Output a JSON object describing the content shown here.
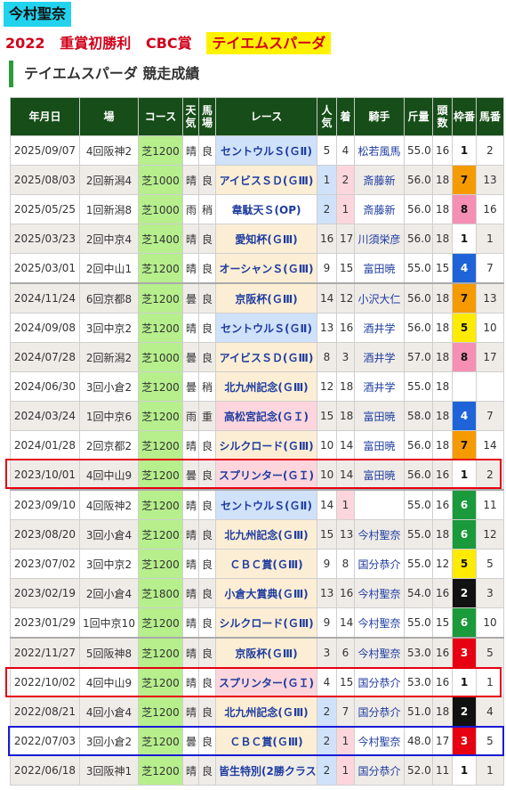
{
  "jockey": "今村聖奈",
  "headline": {
    "year": "2022",
    "title": "重賞初勝利",
    "race": "CBC賞",
    "horse": "テイエムスパーダ"
  },
  "section": {
    "horse": "テイエムスパーダ",
    "label": "競走成績"
  },
  "colors": {
    "header_bg": "#164d18",
    "course_bg": "#b6ef8c",
    "g1_bg": "#fcd6dc",
    "g2_bg": "#cfe2fa",
    "g3_bg": "#fbeed4",
    "accent_red": "#e60012",
    "accent_blue": "#1a1ad6"
  },
  "columns": [
    "年月日",
    "場",
    "コース",
    "天気",
    "馬場",
    "レース",
    "人気",
    "着",
    "騎手",
    "斤量",
    "頭数",
    "枠番",
    "馬番"
  ],
  "rows": [
    {
      "date": "2025/09/07",
      "track": "4回阪神2",
      "course": "芝1200",
      "weather": "晴",
      "going": "良",
      "race": "セントウルＳ(ＧⅡ)",
      "grade": "g2",
      "pop": "5",
      "finish": "4",
      "jockey": "松若風馬",
      "weight": "55.0",
      "field": "16",
      "waku": "1",
      "umaban": "2"
    },
    {
      "date": "2025/08/03",
      "track": "2回新潟4",
      "course": "芝1000",
      "weather": "晴",
      "going": "良",
      "race": "アイビスＳＤ(ＧⅢ)",
      "grade": "g3",
      "pop": "1",
      "finish": "2",
      "jockey": "斎藤新",
      "weight": "56.0",
      "field": "18",
      "waku": "7",
      "umaban": "13"
    },
    {
      "date": "2025/05/25",
      "track": "1回新潟8",
      "course": "芝1000",
      "weather": "雨",
      "going": "稍",
      "race": "韋駄天Ｓ(OP)",
      "grade": "op",
      "pop": "2",
      "finish": "1",
      "jockey": "斎藤新",
      "weight": "56.0",
      "field": "18",
      "waku": "8",
      "umaban": "16"
    },
    {
      "date": "2025/03/23",
      "track": "2回中京4",
      "course": "芝1400",
      "weather": "晴",
      "going": "良",
      "race": "愛知杯(ＧⅢ)",
      "grade": "g3",
      "pop": "16",
      "finish": "17",
      "jockey": "川須栄彦",
      "weight": "56.0",
      "field": "18",
      "waku": "1",
      "umaban": "1"
    },
    {
      "date": "2025/03/01",
      "track": "2回中山1",
      "course": "芝1200",
      "weather": "晴",
      "going": "良",
      "race": "オーシャンＳ(ＧⅢ)",
      "grade": "g3",
      "pop": "9",
      "finish": "15",
      "jockey": "富田暁",
      "weight": "55.0",
      "field": "15",
      "waku": "4",
      "umaban": "7"
    },
    {
      "date": "2024/11/24",
      "track": "6回京都8",
      "course": "芝1200",
      "weather": "曇",
      "going": "良",
      "race": "京阪杯(ＧⅢ)",
      "grade": "g3",
      "pop": "14",
      "finish": "12",
      "jockey": "小沢大仁",
      "weight": "56.0",
      "field": "18",
      "waku": "7",
      "umaban": "13"
    },
    {
      "date": "2024/09/08",
      "track": "3回中京2",
      "course": "芝1200",
      "weather": "晴",
      "going": "良",
      "race": "セントウルＳ(ＧⅡ)",
      "grade": "g2",
      "pop": "13",
      "finish": "16",
      "jockey": "酒井学",
      "weight": "56.0",
      "field": "18",
      "waku": "5",
      "umaban": "10"
    },
    {
      "date": "2024/07/28",
      "track": "2回新潟2",
      "course": "芝1000",
      "weather": "曇",
      "going": "良",
      "race": "アイビスＳＤ(ＧⅢ)",
      "grade": "g3",
      "pop": "8",
      "finish": "3",
      "jockey": "酒井学",
      "weight": "57.0",
      "field": "18",
      "waku": "8",
      "umaban": "17"
    },
    {
      "date": "2024/06/30",
      "track": "3回小倉2",
      "course": "芝1200",
      "weather": "曇",
      "going": "稍",
      "race": "北九州記念(ＧⅢ)",
      "grade": "g3",
      "pop": "12",
      "finish": "18",
      "jockey": "酒井学",
      "weight": "55.0",
      "field": "18",
      "waku": "",
      "umaban": ""
    },
    {
      "date": "2024/03/24",
      "track": "1回中京6",
      "course": "芝1200",
      "weather": "雨",
      "going": "重",
      "race": "高松宮記念(ＧＩ)",
      "grade": "g1",
      "pop": "15",
      "finish": "18",
      "jockey": "富田暁",
      "weight": "58.0",
      "field": "18",
      "waku": "4",
      "umaban": "7"
    },
    {
      "date": "2024/01/28",
      "track": "2回京都2",
      "course": "芝1200",
      "weather": "晴",
      "going": "良",
      "race": "シルクロード(ＧⅢ)",
      "grade": "g3",
      "pop": "10",
      "finish": "14",
      "jockey": "富田暁",
      "weight": "56.0",
      "field": "18",
      "waku": "7",
      "umaban": "14"
    },
    {
      "date": "2023/10/01",
      "track": "4回中山9",
      "course": "芝1200",
      "weather": "曇",
      "going": "良",
      "race": "スプリンター(ＧＩ)",
      "grade": "g1",
      "pop": "10",
      "finish": "14",
      "jockey": "富田暁",
      "weight": "56.0",
      "field": "16",
      "waku": "1",
      "umaban": "2"
    },
    {
      "date": "2023/09/10",
      "track": "4回阪神2",
      "course": "芝1200",
      "weather": "晴",
      "going": "良",
      "race": "セントウルＳ(ＧⅡ)",
      "grade": "g2",
      "pop": "14",
      "finish": "1",
      "jockey": "",
      "weight": "55.0",
      "field": "16",
      "waku": "6",
      "umaban": "11"
    },
    {
      "date": "2023/08/20",
      "track": "3回小倉4",
      "course": "芝1200",
      "weather": "晴",
      "going": "良",
      "race": "北九州記念(ＧⅢ)",
      "grade": "g3",
      "pop": "15",
      "finish": "13",
      "jockey": "今村聖奈",
      "weight": "55.0",
      "field": "18",
      "waku": "6",
      "umaban": "12"
    },
    {
      "date": "2023/07/02",
      "track": "3回中京2",
      "course": "芝1200",
      "weather": "晴",
      "going": "良",
      "race": "ＣＢＣ賞(ＧⅢ)",
      "grade": "g3",
      "pop": "9",
      "finish": "8",
      "jockey": "国分恭介",
      "weight": "55.0",
      "field": "12",
      "waku": "5",
      "umaban": "5"
    },
    {
      "date": "2023/02/19",
      "track": "2回小倉4",
      "course": "芝1800",
      "weather": "晴",
      "going": "良",
      "race": "小倉大賞典(ＧⅢ)",
      "grade": "g3",
      "pop": "13",
      "finish": "16",
      "jockey": "今村聖奈",
      "weight": "54.0",
      "field": "16",
      "waku": "2",
      "umaban": "3"
    },
    {
      "date": "2023/01/29",
      "track": "1回中京10",
      "course": "芝1200",
      "weather": "晴",
      "going": "良",
      "race": "シルクロード(ＧⅢ)",
      "grade": "g3",
      "pop": "9",
      "finish": "14",
      "jockey": "今村聖奈",
      "weight": "55.0",
      "field": "15",
      "waku": "6",
      "umaban": "10"
    },
    {
      "date": "2022/11/27",
      "track": "5回阪神8",
      "course": "芝1200",
      "weather": "晴",
      "going": "良",
      "race": "京阪杯(ＧⅢ)",
      "grade": "g3",
      "pop": "3",
      "finish": "6",
      "jockey": "今村聖奈",
      "weight": "53.0",
      "field": "16",
      "waku": "3",
      "umaban": "5"
    },
    {
      "date": "2022/10/02",
      "track": "4回中山9",
      "course": "芝1200",
      "weather": "晴",
      "going": "良",
      "race": "スプリンター(ＧＩ)",
      "grade": "g1",
      "pop": "4",
      "finish": "15",
      "jockey": "国分恭介",
      "weight": "53.0",
      "field": "16",
      "waku": "1",
      "umaban": "1"
    },
    {
      "date": "2022/08/21",
      "track": "4回小倉4",
      "course": "芝1200",
      "weather": "晴",
      "going": "良",
      "race": "北九州記念(ＧⅢ)",
      "grade": "g3",
      "pop": "2",
      "finish": "7",
      "jockey": "国分恭介",
      "weight": "51.0",
      "field": "18",
      "waku": "2",
      "umaban": "4"
    },
    {
      "date": "2022/07/03",
      "track": "3回小倉2",
      "course": "芝1200",
      "weather": "曇",
      "going": "良",
      "race": "ＣＢＣ賞(ＧⅢ)",
      "grade": "g3",
      "pop": "2",
      "finish": "1",
      "jockey": "今村聖奈",
      "weight": "48.0",
      "field": "17",
      "waku": "3",
      "umaban": "5"
    },
    {
      "date": "2022/06/18",
      "track": "3回阪神1",
      "course": "芝1200",
      "weather": "晴",
      "going": "良",
      "race": "皆生特別(2勝クラス)",
      "grade": "cls",
      "pop": "2",
      "finish": "1",
      "jockey": "国分恭介",
      "weight": "52.0",
      "field": "11",
      "waku": "1",
      "umaban": "1"
    }
  ]
}
